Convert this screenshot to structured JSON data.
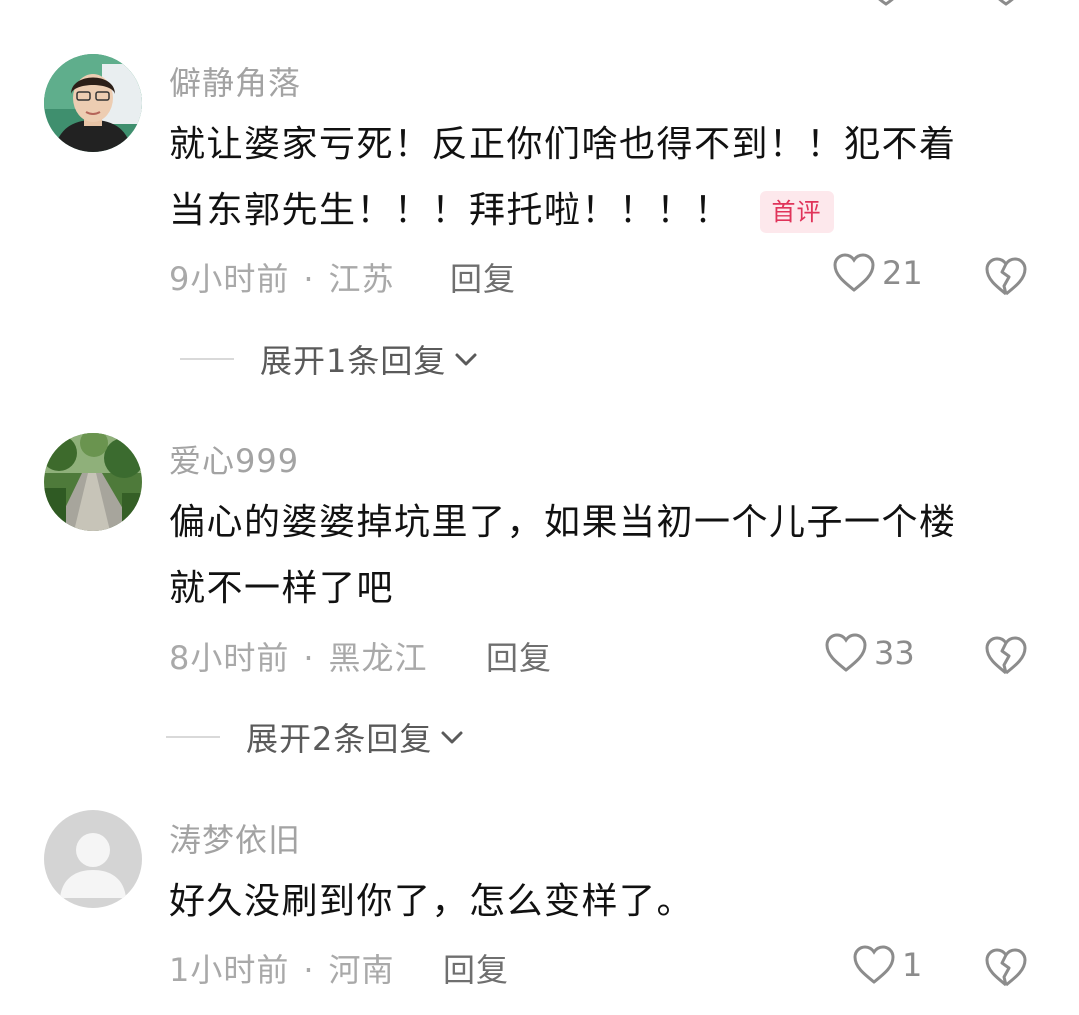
{
  "comments": [
    {
      "username": "僻静角落",
      "text_line1": "就让婆家亏死！反正你们啥也得不到！！犯不着",
      "text_line2": "当东郭先生！！！拜托啦！！！！",
      "badge": "首评",
      "time": "9小时前",
      "location": "江苏",
      "reply_label": "回复",
      "likes": "21",
      "expand_label": "展开1条回复"
    },
    {
      "username": "爱心999",
      "text_line1": "偏心的婆婆掉坑里了，如果当初一个儿子一个楼",
      "text_line2": "就不一样了吧",
      "time": "8小时前",
      "location": "黑龙江",
      "reply_label": "回复",
      "likes": "33",
      "expand_label": "展开2条回复"
    },
    {
      "username": "涛梦依旧",
      "text_line1": "好久没刷到你了，怎么变样了。",
      "time": "1小时前",
      "location": "河南",
      "reply_label": "回复",
      "likes": "1"
    }
  ],
  "meta_separator": "·",
  "colors": {
    "username": "#a3a3a3",
    "text": "#111111",
    "badge_text": "#e0345a",
    "badge_bg": "#fde8ec",
    "meta": "#a9a9a9"
  },
  "icons": {
    "like": "heart-outline-icon",
    "dislike": "broken-heart-icon",
    "expand": "chevron-down-icon"
  }
}
